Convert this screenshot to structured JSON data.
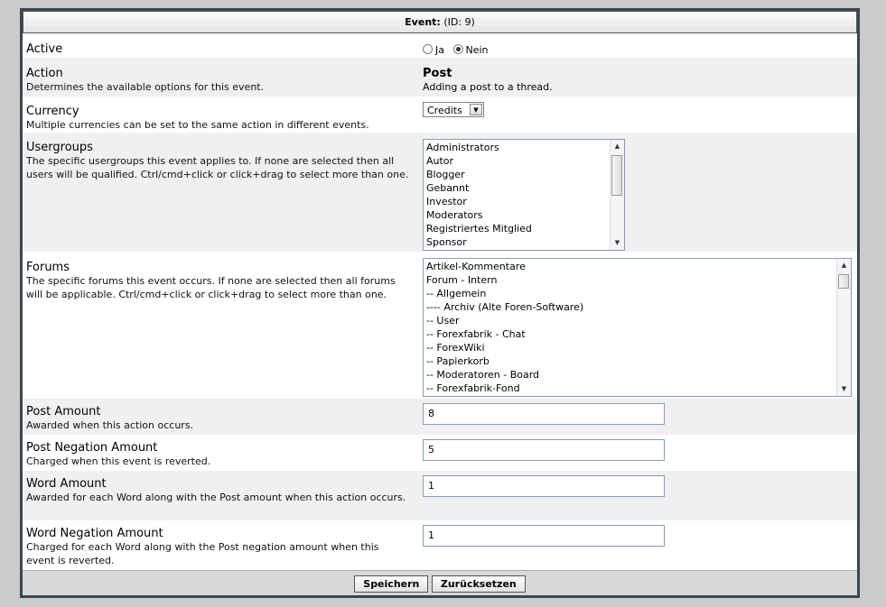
{
  "header": {
    "label": "Event:",
    "id_text": "(ID: 9)"
  },
  "active": {
    "title": "Active",
    "options": [
      {
        "label": "Ja",
        "checked": false
      },
      {
        "label": "Nein",
        "checked": true
      }
    ]
  },
  "action": {
    "title": "Action",
    "desc": "Determines the available options for this event.",
    "value_title": "Post",
    "value_desc": "Adding a post to a thread."
  },
  "currency": {
    "title": "Currency",
    "desc": "Multiple currencies can be set to the same action in different events.",
    "selected": "Credits"
  },
  "usergroups": {
    "title": "Usergroups",
    "desc": "The specific usergroups this event applies to. If none are selected then all users will be qualified. Ctrl/cmd+click or click+drag to select more than one.",
    "options": [
      "Administrators",
      "Autor",
      "Blogger",
      "Gebannt",
      "Investor",
      "Moderators",
      "Registriertes Mitglied",
      "Sponsor"
    ]
  },
  "forums": {
    "title": "Forums",
    "desc": "The specific forums this event occurs. If none are selected then all forums will be applicable. Ctrl/cmd+click or click+drag to select more than one.",
    "options": [
      "Artikel-Kommentare",
      "Forum - Intern",
      "-- Allgemein",
      "---- Archiv (Alte Foren-Software)",
      "-- User",
      "-- Forexfabrik - Chat",
      "-- ForexWiki",
      "-- Papierkorb",
      "-- Moderatoren - Board",
      "-- Forexfabrik-Fond"
    ]
  },
  "post_amount": {
    "title": "Post Amount",
    "desc": "Awarded when this action occurs.",
    "value": "8"
  },
  "post_negation": {
    "title": "Post Negation Amount",
    "desc": "Charged when this event is reverted.",
    "value": "5"
  },
  "word_amount": {
    "title": "Word Amount",
    "desc": "Awarded for each Word along with the Post amount when this action occurs.",
    "value": "1"
  },
  "word_negation": {
    "title": "Word Negation Amount",
    "desc": "Charged for each Word along with the Post negation amount when this event is reverted.",
    "value": "1"
  },
  "footer": {
    "save_label": "Speichern",
    "reset_label": "Zurücksetzen"
  }
}
